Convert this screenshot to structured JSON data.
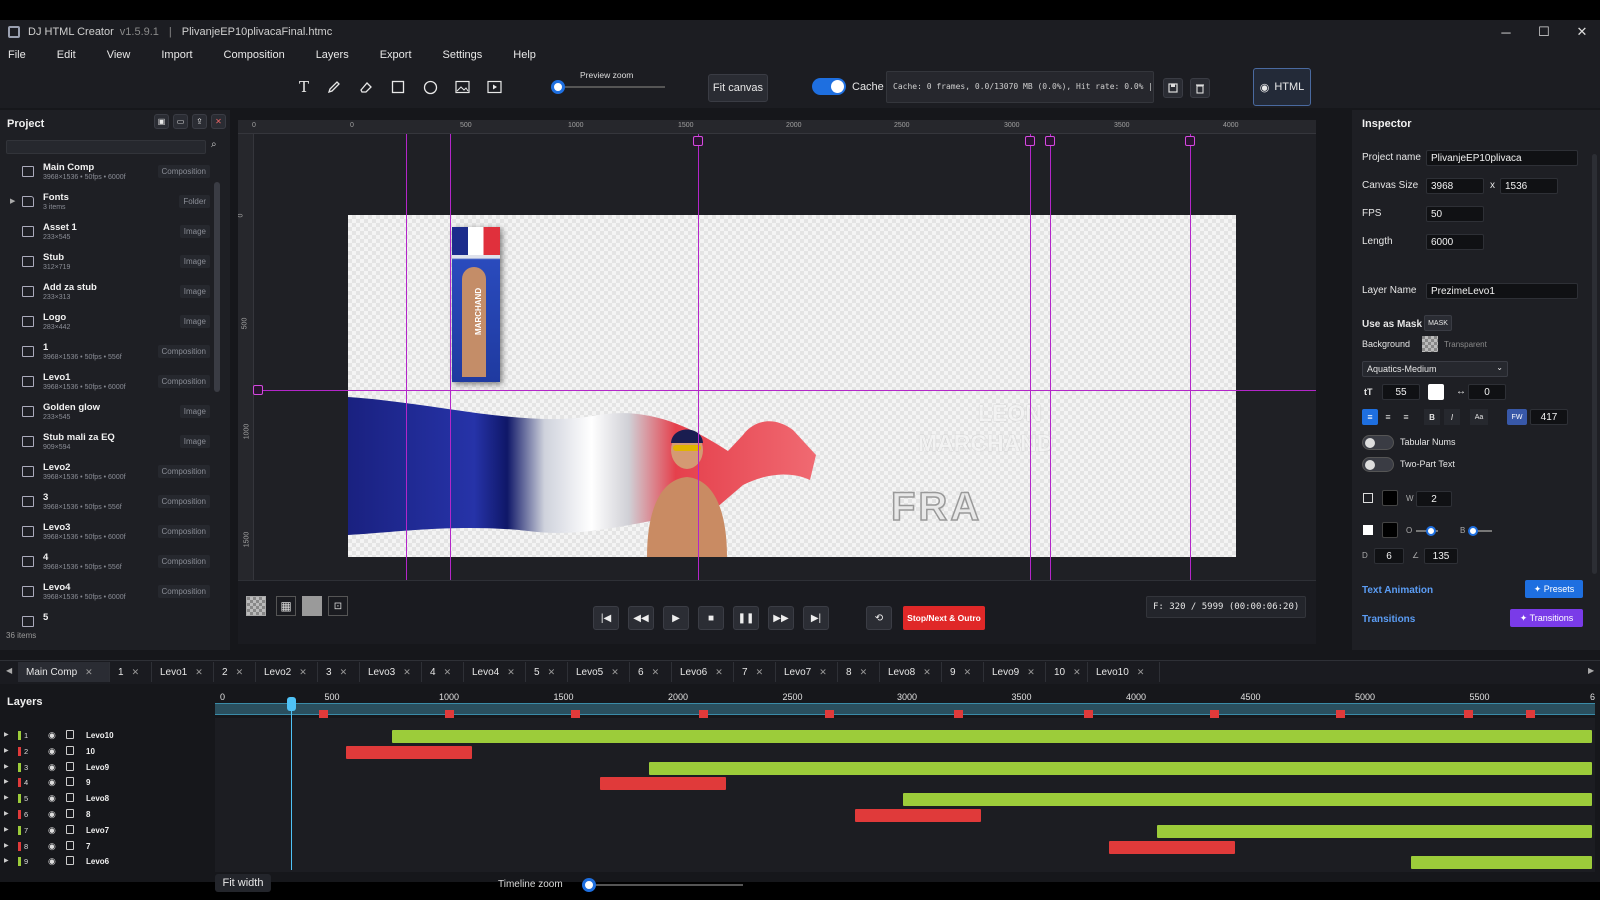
{
  "window": {
    "app_name": "DJ HTML Creator",
    "version": "v1.5.9.1",
    "separator": "|",
    "file_name": "PlivanjeEP10plivacaFinal.htmc",
    "min": "─",
    "max": "☐",
    "close": "✕"
  },
  "menu": [
    "File",
    "Edit",
    "View",
    "Import",
    "Composition",
    "Layers",
    "Export",
    "Settings",
    "Help"
  ],
  "toolbar": {
    "preview_zoom_label": "Preview zoom",
    "preview_zoom_value": 0.05,
    "fit_canvas": "Fit canvas",
    "cache_label": "Cache",
    "cache_on": true,
    "cache_info": "Cache: 0 frames, 0.0/13070 MB (0.0%), Hit rate: 0.0%  |",
    "html_label": "HTML"
  },
  "project": {
    "title": "Project",
    "count": "36 items",
    "items": [
      {
        "name": "Main Comp",
        "meta": "3968×1536 • 50fps • 6000f",
        "type": "Composition",
        "kind": "comp"
      },
      {
        "name": "Fonts",
        "meta": "3 items",
        "type": "Folder",
        "kind": "folder"
      },
      {
        "name": "Asset 1",
        "meta": "233×545",
        "type": "Image",
        "kind": "image"
      },
      {
        "name": "Stub",
        "meta": "312×719",
        "type": "Image",
        "kind": "image"
      },
      {
        "name": "Add za stub",
        "meta": "233×313",
        "type": "Image",
        "kind": "image"
      },
      {
        "name": "Logo",
        "meta": "283×442",
        "type": "Image",
        "kind": "image"
      },
      {
        "name": "1",
        "meta": "3968×1536 • 50fps • 556f",
        "type": "Composition",
        "kind": "comp"
      },
      {
        "name": "Levo1",
        "meta": "3968×1536 • 50fps • 6000f",
        "type": "Composition",
        "kind": "comp"
      },
      {
        "name": "Golden glow",
        "meta": "233×545",
        "type": "Image",
        "kind": "image"
      },
      {
        "name": "Stub mali za EQ",
        "meta": "909×594",
        "type": "Image",
        "kind": "image"
      },
      {
        "name": "Levo2",
        "meta": "3968×1536 • 50fps • 6000f",
        "type": "Composition",
        "kind": "comp"
      },
      {
        "name": "3",
        "meta": "3968×1536 • 50fps • 556f",
        "type": "Composition",
        "kind": "comp"
      },
      {
        "name": "Levo3",
        "meta": "3968×1536 • 50fps • 6000f",
        "type": "Composition",
        "kind": "comp"
      },
      {
        "name": "4",
        "meta": "3968×1536 • 50fps • 556f",
        "type": "Composition",
        "kind": "comp"
      },
      {
        "name": "Levo4",
        "meta": "3968×1536 • 50fps • 6000f",
        "type": "Composition",
        "kind": "comp"
      },
      {
        "name": "5",
        "meta": "",
        "type": "",
        "kind": "comp"
      }
    ]
  },
  "stage": {
    "ruler_h": [
      "0",
      "0",
      "500",
      "1000",
      "1500",
      "2000",
      "2500",
      "3000",
      "3500",
      "4000"
    ],
    "ruler_v": [
      "0",
      "500",
      "1000",
      "1500"
    ],
    "canvas_text": {
      "first": "LEON",
      "last": "MARCHAND",
      "country": "FRA",
      "vertical": "MARCHAND"
    }
  },
  "transport": {
    "stop_next": "Stop/Next & Outro",
    "frame_info": "F: 320 / 5999 (00:00:06:20)"
  },
  "inspector": {
    "title": "Inspector",
    "project_name_label": "Project name",
    "project_name": "PlivanjeEP10plivaca",
    "canvas_size_label": "Canvas Size",
    "canvas_w": "3968",
    "canvas_x": "x",
    "canvas_h": "1536",
    "fps_label": "FPS",
    "fps": "50",
    "length_label": "Length",
    "length": "6000",
    "layer_name_label": "Layer Name",
    "layer_name": "PrezimeLevo1",
    "use_as_mask": "Use as Mask",
    "mask_btn": "MASK",
    "background_label": "Background",
    "background_value": "Transparent",
    "font": "Aquatics-Medium",
    "font_size_icon": "tT",
    "font_size": "55",
    "tracking_icon": "↔",
    "tracking": "0",
    "bold": "B",
    "italic": "I",
    "case": "Aa",
    "fw_label": "FW",
    "font_weight": "417",
    "tabular_nums": "Tabular Nums",
    "two_part_text": "Two-Part Text",
    "stroke_w_label": "W",
    "stroke_w": "2",
    "shadow_o_label": "O",
    "shadow_b_label": "B",
    "shadow_d_label": "D",
    "shadow_d": "6",
    "shadow_angle_label": "∠",
    "shadow_angle": "135",
    "text_animation": "Text Animation",
    "presets_btn": "✦ Presets",
    "transitions": "Transitions",
    "transitions_btn": "✦ Transitions"
  },
  "tabs": [
    {
      "label": "Main Comp",
      "active": true
    },
    {
      "label": "1"
    },
    {
      "label": "Levo1"
    },
    {
      "label": "2"
    },
    {
      "label": "Levo2"
    },
    {
      "label": "3"
    },
    {
      "label": "Levo3"
    },
    {
      "label": "4"
    },
    {
      "label": "Levo4"
    },
    {
      "label": "5"
    },
    {
      "label": "Levo5"
    },
    {
      "label": "6"
    },
    {
      "label": "Levo6"
    },
    {
      "label": "7"
    },
    {
      "label": "Levo7"
    },
    {
      "label": "8"
    },
    {
      "label": "Levo8"
    },
    {
      "label": "9"
    },
    {
      "label": "Levo9"
    },
    {
      "label": "10"
    },
    {
      "label": "Levo10"
    }
  ],
  "timeline": {
    "layers_title": "Layers",
    "ticks": [
      "0",
      "500",
      "1000",
      "1500",
      "2000",
      "2500",
      "3000",
      "3500",
      "4000",
      "4500",
      "5000",
      "5500",
      "6"
    ],
    "playhead_frame": 320,
    "total_frames": 6000,
    "fit_width": "Fit width",
    "timeline_zoom": "Timeline zoom",
    "layers": [
      {
        "num": "1",
        "name": "Levo10",
        "color": "#9ccc3a",
        "start": 760,
        "end": 6000
      },
      {
        "num": "2",
        "name": "10",
        "color": "#e03a3a",
        "start": 560,
        "end": 1110
      },
      {
        "num": "3",
        "name": "Levo9",
        "color": "#9ccc3a",
        "start": 1880,
        "end": 6000
      },
      {
        "num": "4",
        "name": "9",
        "color": "#e03a3a",
        "start": 1670,
        "end": 2220
      },
      {
        "num": "5",
        "name": "Levo8",
        "color": "#9ccc3a",
        "start": 2990,
        "end": 6000
      },
      {
        "num": "6",
        "name": "8",
        "color": "#e03a3a",
        "start": 2780,
        "end": 3330
      },
      {
        "num": "7",
        "name": "Levo7",
        "color": "#9ccc3a",
        "start": 4100,
        "end": 6000
      },
      {
        "num": "8",
        "name": "7",
        "color": "#e03a3a",
        "start": 3890,
        "end": 4440
      },
      {
        "num": "9",
        "name": "Levo6",
        "color": "#9ccc3a",
        "start": 5210,
        "end": 6000
      }
    ],
    "keyframes": [
      460,
      1010,
      1560,
      2120,
      2670,
      3230,
      3800,
      4350,
      4900,
      5460,
      5730
    ]
  },
  "colors": {
    "accent": "#1e6fe0",
    "guide": "#b326c9",
    "clip_green": "#9ccc3a",
    "clip_red": "#e03a3a",
    "stop_red": "#e02828",
    "transitions": "#7a3be8"
  }
}
